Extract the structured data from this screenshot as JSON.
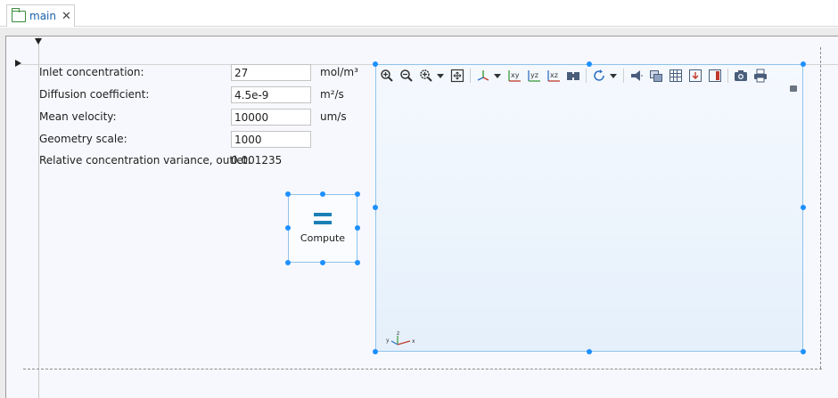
{
  "tab": {
    "label": "main",
    "close_glyph": "✕"
  },
  "form": {
    "rows": [
      {
        "label": "Inlet concentration:",
        "value": "27",
        "unit": "mol/m³"
      },
      {
        "label": "Diffusion coefficient:",
        "value": "4.5e-9",
        "unit": "m²/s"
      },
      {
        "label": "Mean velocity:",
        "value": "10000",
        "unit": "um/s"
      },
      {
        "label": "Geometry scale:",
        "value": "1000",
        "unit": ""
      }
    ],
    "result_label": "Relative concentration variance, outlet:",
    "result_value": "0.001235"
  },
  "compute": {
    "label": "Compute",
    "icon": "equals-icon"
  },
  "graphics": {
    "toolbar_icons": [
      "zoom-in-icon",
      "zoom-out-icon",
      "zoom-box-icon",
      "zoom-extents-icon",
      "view-axis-icon",
      "xy-view-icon",
      "yz-view-icon",
      "xz-view-icon",
      "camera-view-icon",
      "rotate-icon",
      "scene-light-icon",
      "transparency-icon",
      "wireframe-icon",
      "render-down-icon",
      "color-legend-icon",
      "screenshot-icon",
      "print-icon"
    ],
    "triad_axes": [
      "x",
      "y",
      "z"
    ]
  },
  "colors": {
    "accent": "#1b7fb6",
    "selection": "#1e90ff",
    "tab_text": "#1a5fa8",
    "folder": "#3a8a3a"
  }
}
